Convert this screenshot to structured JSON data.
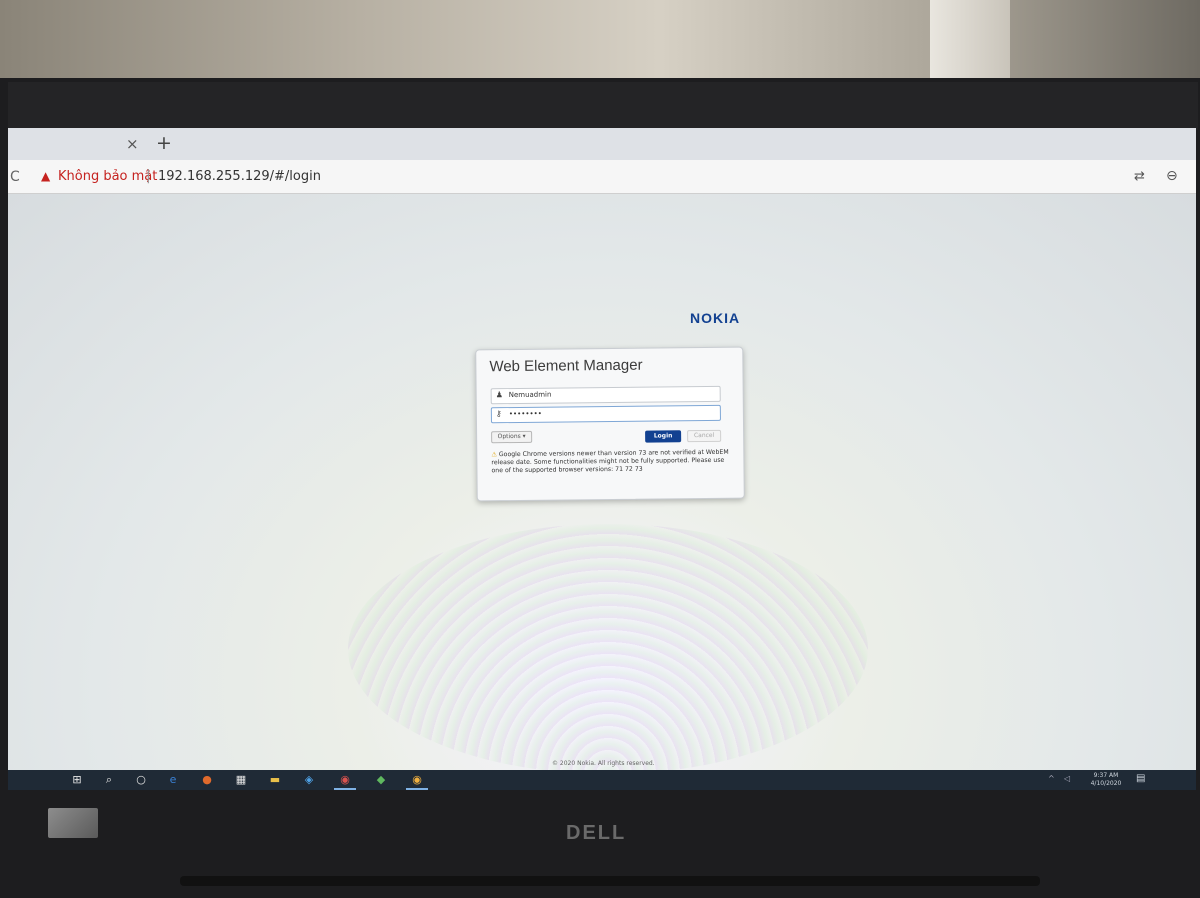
{
  "browser": {
    "tab_close_glyph": "×",
    "tab_new_glyph": "+",
    "security_warning": "Không bảo mật",
    "separator": "|",
    "url": "192.168.255.129/#/login"
  },
  "page": {
    "logo": "NOKIA",
    "login": {
      "title": "Web Element Manager",
      "username_value": "Nemuadmin",
      "password_value": "••••••••",
      "options_label": "Options ▾",
      "login_label": "Login",
      "cancel_label": "Cancel",
      "warning_text": "Google Chrome versions newer than version 73 are not verified at WebEM release date. Some functionalities might not be fully supported. Please use one of the supported browser versions: 71 72 73"
    },
    "footer": "© 2020 Nokia. All rights reserved."
  },
  "taskbar": {
    "clock_time": "9:37 AM",
    "clock_date": "4/10/2020"
  },
  "laptop": {
    "brand": "DELL"
  },
  "colors": {
    "nokia_blue": "#124191",
    "warning_red": "#c5221f"
  }
}
